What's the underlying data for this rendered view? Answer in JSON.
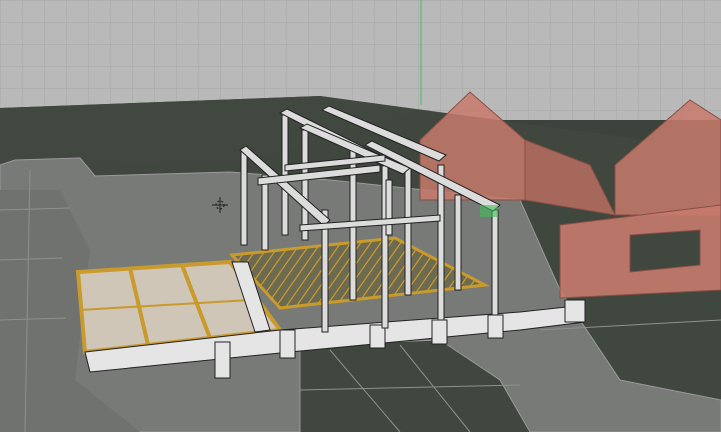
{
  "app": {
    "view": "3d-viewport",
    "projection": "perspective",
    "shading": "wireframe-overlay"
  },
  "colors": {
    "sky_grid_bg": "#b9b9b9",
    "grid_line": "#a6a6a6",
    "ground": "#3f473f",
    "ground_dark": "#353b35",
    "paving": "#7a7a7a",
    "paving_line": "#9a9a9a",
    "timber": "#c99a2c",
    "frame": "#d8d8d8",
    "frame_edge": "#222222",
    "ghost_building": "#c77a6b",
    "axis_green": "#3fbf5a",
    "slab": "#cfc6b7"
  },
  "icons": {
    "cursor": "3d-cursor-icon"
  }
}
